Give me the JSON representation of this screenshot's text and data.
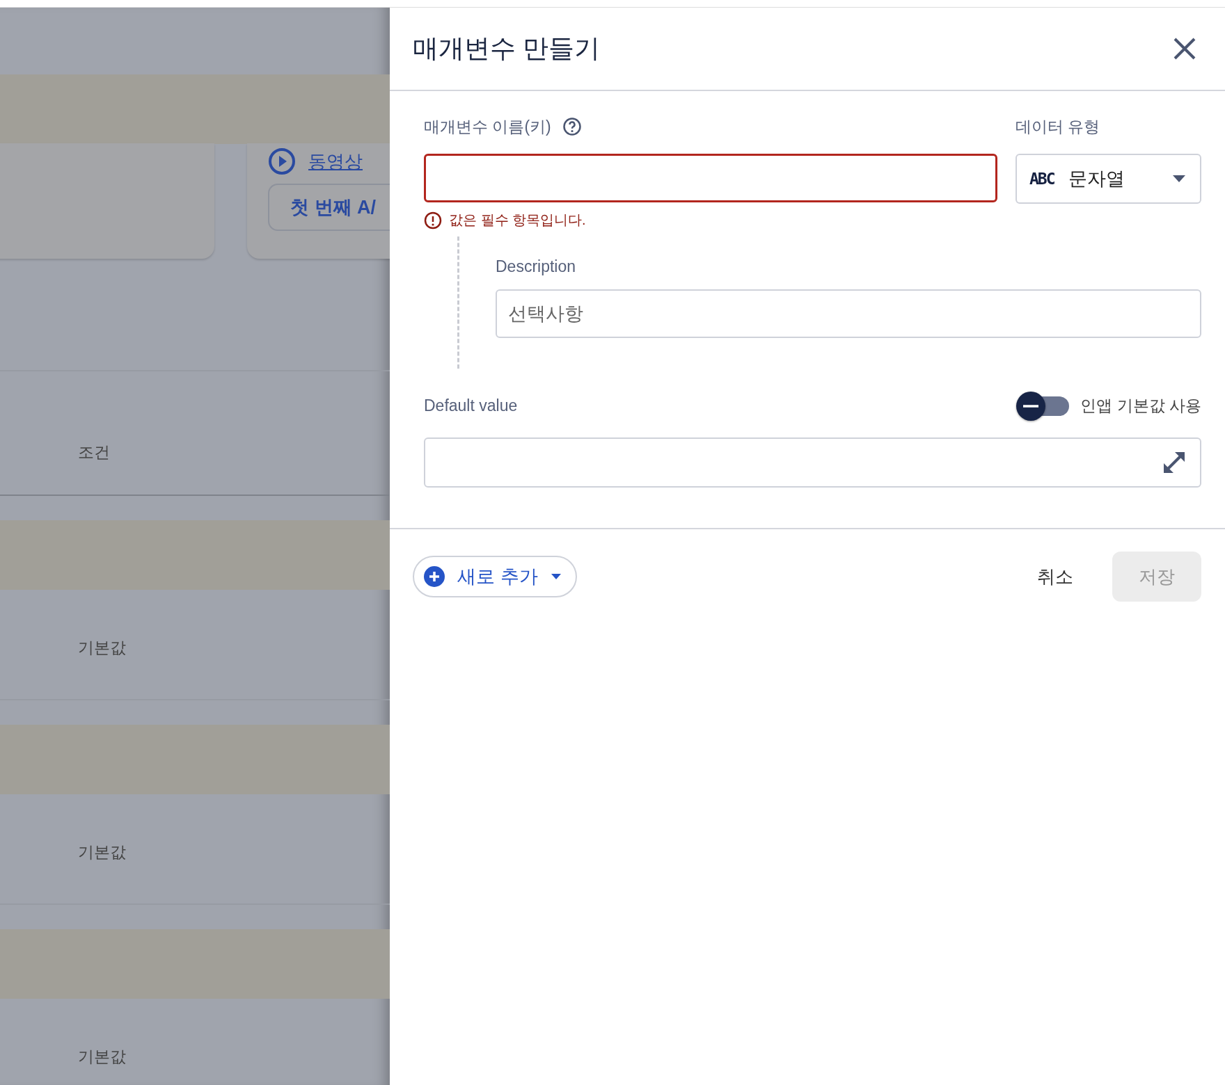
{
  "backdrop": {
    "link": "동영상",
    "button": "첫 번째 A/",
    "column_header": "조건",
    "rows": [
      {
        "label": "기본값"
      },
      {
        "label": "기본값"
      },
      {
        "label": "기본값"
      }
    ]
  },
  "dialog": {
    "title": "매개변수 만들기",
    "name_field": {
      "label": "매개변수 이름(키)",
      "invalid": true,
      "error": "값은 필수 항목입니다."
    },
    "data_type": {
      "label": "데이터 유형",
      "badge": "ABC",
      "value": "문자열"
    },
    "description": {
      "label": "Description",
      "placeholder": "선택사항"
    },
    "default_value": {
      "label": "Default value",
      "toggle": {
        "label": "인앱 기본값 사용",
        "on": false
      }
    },
    "footer": {
      "add_button": "새로 추가",
      "cancel": "취소",
      "save": {
        "label": "저장",
        "disabled": true
      }
    }
  }
}
